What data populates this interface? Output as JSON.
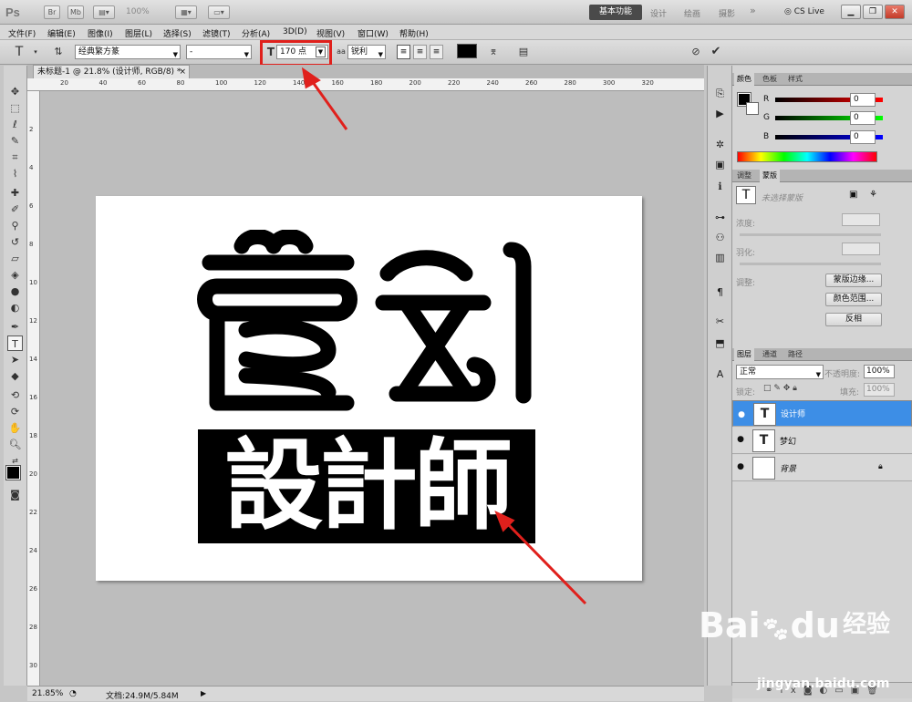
{
  "app": {
    "logo": "Ps",
    "zoom_display": "100%",
    "workspaces": [
      "基本功能",
      "设计",
      "绘画",
      "摄影"
    ],
    "more_workspaces": "»",
    "cs_live": "CS Live"
  },
  "menu": [
    "文件(F)",
    "编辑(E)",
    "图像(I)",
    "图层(L)",
    "选择(S)",
    "滤镜(T)",
    "分析(A)",
    "3D(D)",
    "视图(V)",
    "窗口(W)",
    "帮助(H)"
  ],
  "options": {
    "font_family": "经典繁方篆",
    "font_style": "-",
    "font_size": "170 点",
    "antialias_icon": "aa",
    "antialias": "锐利"
  },
  "document": {
    "tab_title": "未标题-1 @ 21.8% (设计师, RGB/8) *",
    "close": "×",
    "text_dream": "梦幻",
    "text_designer": "設計師"
  },
  "ruler": {
    "h_ticks": [
      "20",
      "40",
      "60",
      "80",
      "100",
      "120",
      "140",
      "160",
      "180",
      "200",
      "220",
      "240",
      "260",
      "280",
      "300",
      "320"
    ],
    "v_ticks": [
      "2",
      "4",
      "6",
      "8",
      "10",
      "12",
      "14",
      "16",
      "18",
      "20",
      "22",
      "24",
      "26",
      "28",
      "30"
    ]
  },
  "status": {
    "zoom": "21.85%",
    "doc_size": "文档:24.9M/5.84M"
  },
  "color_panel": {
    "tabs": [
      "颜色",
      "色板",
      "样式"
    ],
    "r_label": "R",
    "g_label": "G",
    "b_label": "B",
    "r": "0",
    "g": "0",
    "b": "0"
  },
  "masks_panel": {
    "tabs": [
      "调整",
      "蒙版"
    ],
    "no_selection": "未选择蒙版",
    "density": "浓度:",
    "feather": "羽化:",
    "refine": "调整:",
    "btn_edge": "蒙版边缘...",
    "btn_color_range": "颜色范围...",
    "btn_invert": "反相"
  },
  "layers_panel": {
    "tabs": [
      "图层",
      "通道",
      "路径"
    ],
    "blend_mode": "正常",
    "opacity_label": "不透明度:",
    "opacity": "100%",
    "lock_label": "锁定:",
    "fill_label": "填充:",
    "fill": "100%",
    "layers": [
      {
        "name": "设计师",
        "thumb": "T",
        "selected": true
      },
      {
        "name": "梦幻",
        "thumb": "T",
        "selected": false
      },
      {
        "name": "背景",
        "thumb": "",
        "selected": false
      }
    ]
  },
  "watermark": {
    "brand": "Bai",
    "brand2": "du",
    "cn": "经验",
    "url": "jingyan.baidu.com"
  },
  "colors": {
    "highlight": "#e0201c",
    "selection": "#3d8ee6"
  }
}
